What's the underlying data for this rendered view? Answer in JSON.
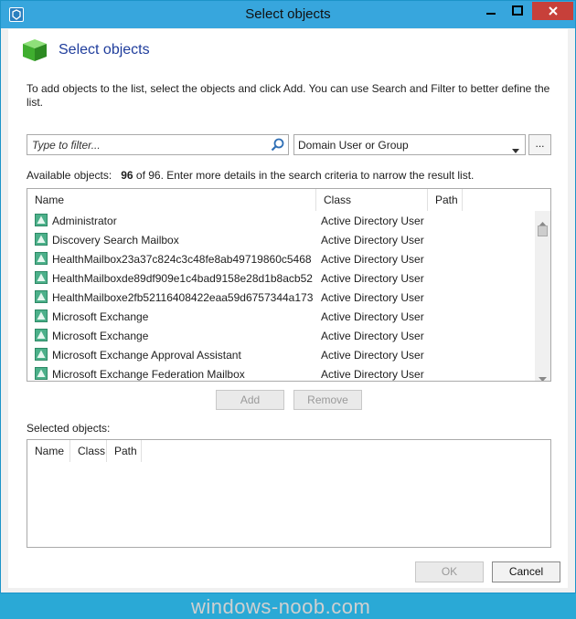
{
  "window": {
    "title": "Select objects"
  },
  "header": {
    "title": "Select objects"
  },
  "instructions": "To add objects to the list, select the objects and click Add. You can use Search and Filter to better define the list.",
  "filter": {
    "placeholder": "Type to filter..."
  },
  "class_combo": {
    "selected": "Domain User or Group"
  },
  "browse_button": {
    "label": "..."
  },
  "available": {
    "label_prefix": "Available objects:",
    "count": "96",
    "label_suffix": "of 96. Enter more details in the search criteria to narrow the result list.",
    "columns": [
      "Name",
      "Class",
      "Path"
    ],
    "rows": [
      {
        "name": "Administrator",
        "class": "Active Directory User"
      },
      {
        "name": "Discovery Search Mailbox",
        "class": "Active Directory User"
      },
      {
        "name": "HealthMailbox23a37c824c3c48fe8ab49719860c5468",
        "class": "Active Directory User"
      },
      {
        "name": "HealthMailboxde89df909e1c4bad9158e28d1b8acb52",
        "class": "Active Directory User"
      },
      {
        "name": "HealthMailboxe2fb52116408422eaa59d6757344a173",
        "class": "Active Directory User"
      },
      {
        "name": "Microsoft Exchange",
        "class": "Active Directory User"
      },
      {
        "name": "Microsoft Exchange",
        "class": "Active Directory User"
      },
      {
        "name": "Microsoft Exchange Approval Assistant",
        "class": "Active Directory User"
      },
      {
        "name": "Microsoft Exchange Federation Mailbox",
        "class": "Active Directory User"
      }
    ]
  },
  "buttons": {
    "add": "Add",
    "remove": "Remove",
    "ok": "OK",
    "cancel": "Cancel"
  },
  "selected": {
    "label": "Selected objects:",
    "columns": [
      "Name",
      "Class",
      "Path"
    ]
  },
  "watermark": "windows-noob.com",
  "colors": {
    "titlebar": "#37a6dd",
    "close": "#c7403a",
    "header_title": "#1f3d9c"
  }
}
